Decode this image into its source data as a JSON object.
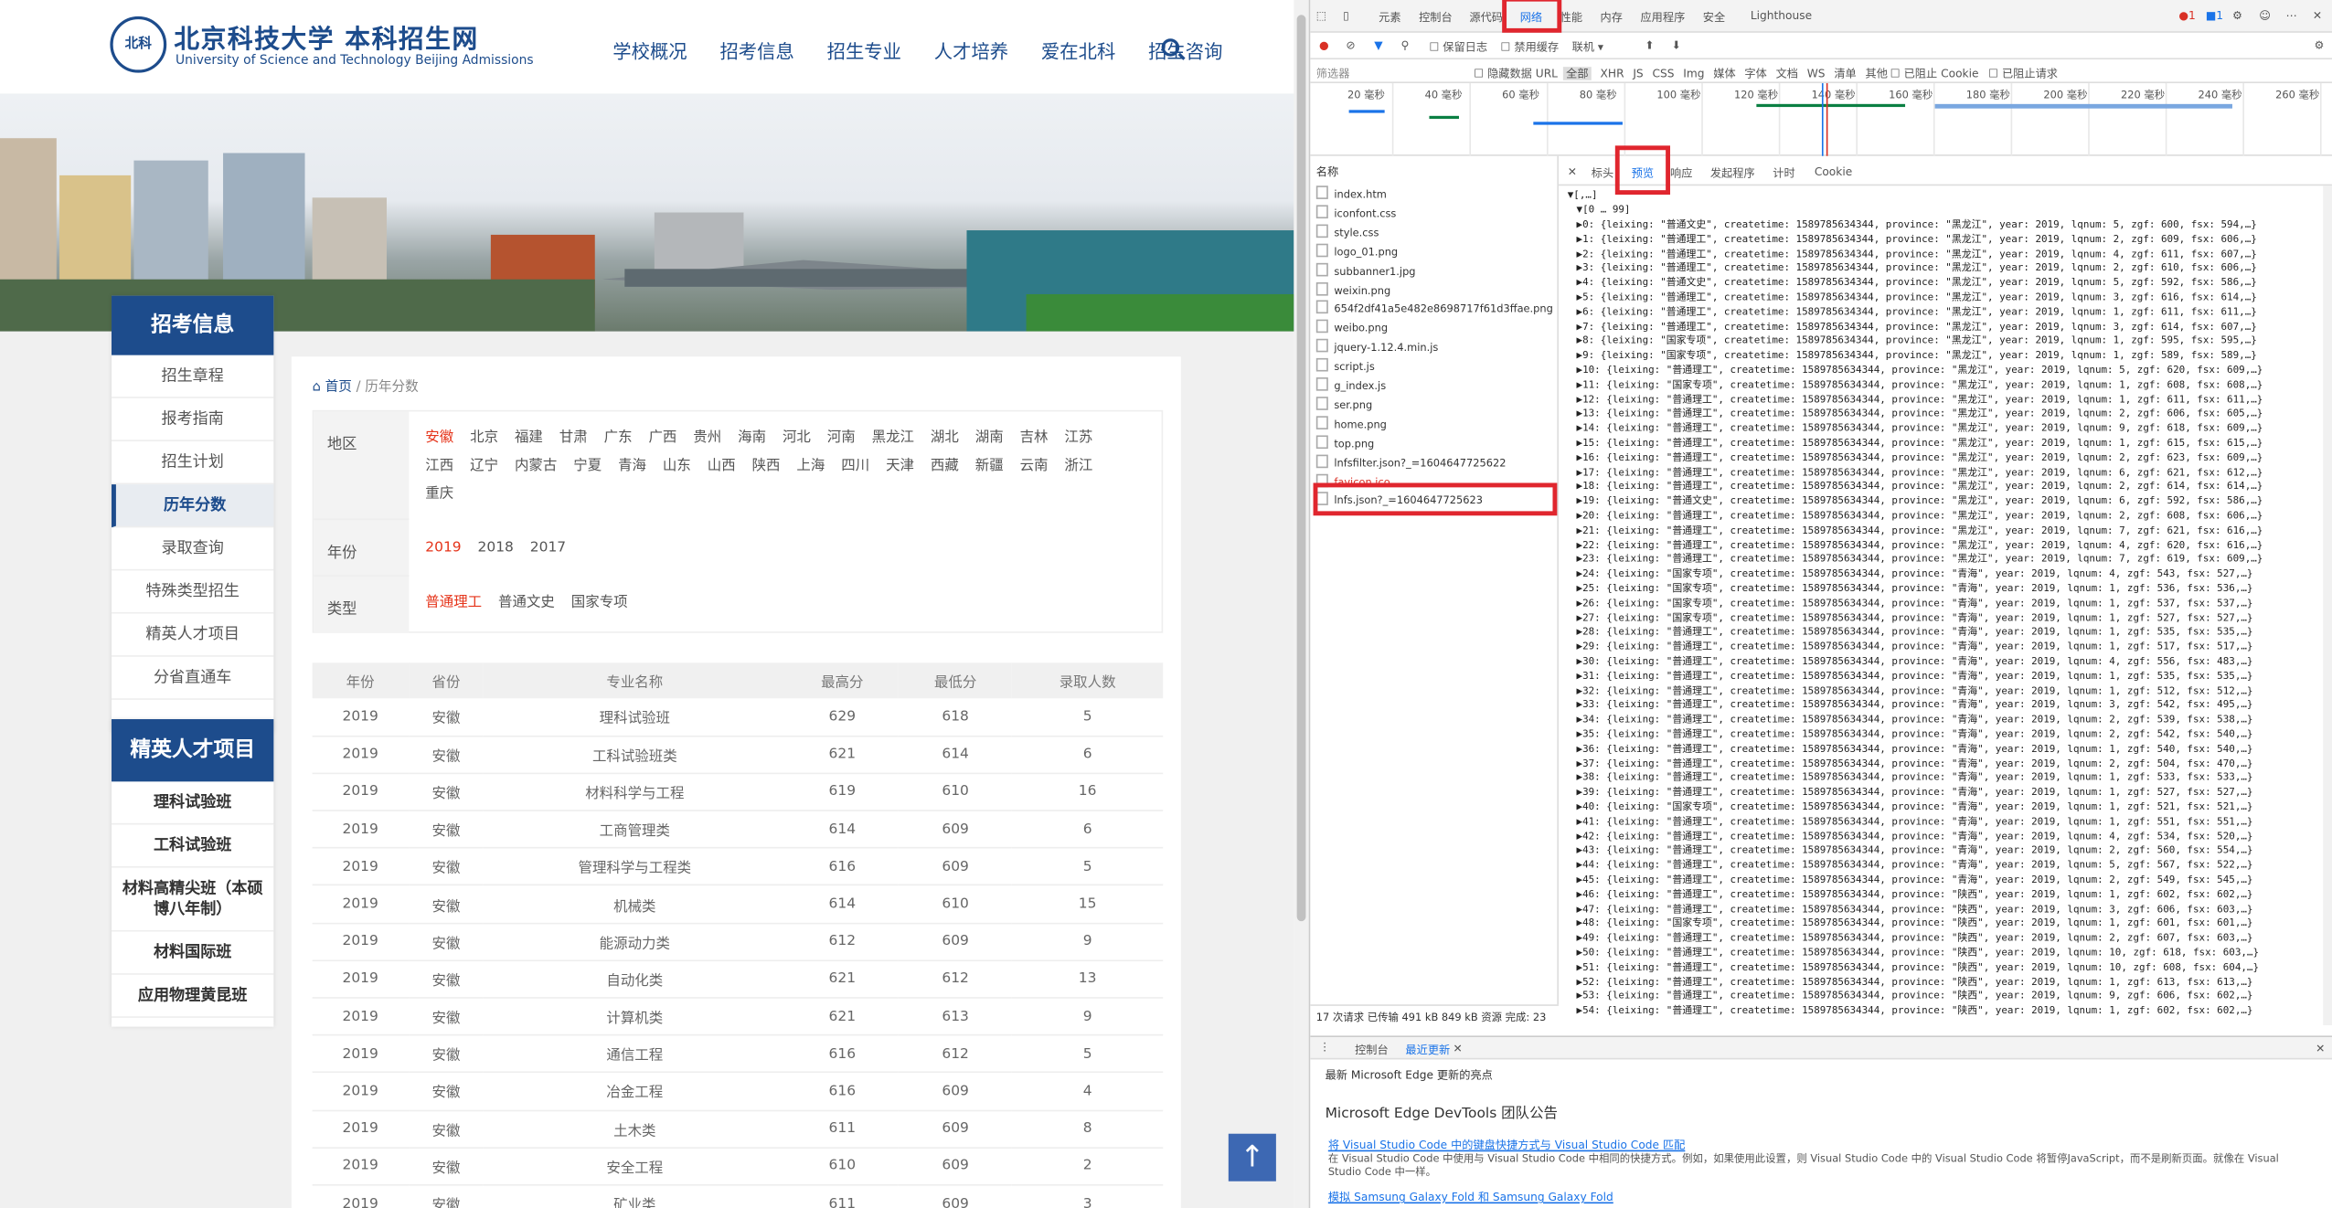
{
  "site": {
    "logo_seal": "北科",
    "logo_cn": "北京科技大学 本科招生网",
    "logo_en": "University of Science and Technology Beijing Admissions",
    "nav": [
      "学校概况",
      "招考信息",
      "招生专业",
      "人才培养",
      "爱在北科",
      "招生咨询"
    ],
    "sidebar1": {
      "title": "招考信息",
      "items": [
        "招生章程",
        "报考指南",
        "招生计划",
        "历年分数",
        "录取查询",
        "特殊类型招生",
        "精英人才项目",
        "分省直通车"
      ],
      "active": 3
    },
    "sidebar2": {
      "title": "精英人才项目",
      "items": [
        "理科试验班",
        "工科试验班",
        "材料高精尖班（本硕博八年制）",
        "材料国际班",
        "应用物理黄昆班"
      ]
    },
    "breadcrumb": {
      "home": "首页",
      "sep": "/",
      "current": "历年分数"
    },
    "filters": {
      "region_label": "地区",
      "regions_row1": [
        "安徽",
        "北京",
        "福建",
        "甘肃",
        "广东",
        "广西",
        "贵州",
        "海南",
        "河北",
        "河南",
        "黑龙江",
        "湖北",
        "湖南",
        "吉林",
        "江苏"
      ],
      "regions_row2": [
        "江西",
        "辽宁",
        "内蒙古",
        "宁夏",
        "青海",
        "山东",
        "山西",
        "陕西",
        "上海",
        "四川",
        "天津",
        "西藏",
        "新疆",
        "云南",
        "浙江"
      ],
      "regions_row3": [
        "重庆"
      ],
      "year_label": "年份",
      "years": [
        "2019",
        "2018",
        "2017"
      ],
      "type_label": "类型",
      "types": [
        "普通理工",
        "普通文史",
        "国家专项"
      ]
    },
    "table": {
      "headers": [
        "年份",
        "省份",
        "专业名称",
        "最高分",
        "最低分",
        "录取人数"
      ],
      "rows": [
        [
          "2019",
          "安徽",
          "理科试验班",
          "629",
          "618",
          "5"
        ],
        [
          "2019",
          "安徽",
          "工科试验班类",
          "621",
          "614",
          "6"
        ],
        [
          "2019",
          "安徽",
          "材料科学与工程",
          "619",
          "610",
          "16"
        ],
        [
          "2019",
          "安徽",
          "工商管理类",
          "614",
          "609",
          "6"
        ],
        [
          "2019",
          "安徽",
          "管理科学与工程类",
          "616",
          "609",
          "5"
        ],
        [
          "2019",
          "安徽",
          "机械类",
          "614",
          "610",
          "15"
        ],
        [
          "2019",
          "安徽",
          "能源动力类",
          "612",
          "609",
          "9"
        ],
        [
          "2019",
          "安徽",
          "自动化类",
          "621",
          "612",
          "13"
        ],
        [
          "2019",
          "安徽",
          "计算机类",
          "621",
          "613",
          "9"
        ],
        [
          "2019",
          "安徽",
          "通信工程",
          "616",
          "612",
          "5"
        ],
        [
          "2019",
          "安徽",
          "冶金工程",
          "616",
          "609",
          "4"
        ],
        [
          "2019",
          "安徽",
          "土木类",
          "611",
          "609",
          "8"
        ],
        [
          "2019",
          "安徽",
          "安全工程",
          "610",
          "609",
          "2"
        ],
        [
          "2019",
          "安徽",
          "矿业类",
          "611",
          "609",
          "3"
        ]
      ]
    },
    "backtop": "↑"
  },
  "devtools": {
    "tabs": [
      "元素",
      "控制台",
      "源代码",
      "网络",
      "性能",
      "内存",
      "应用程序",
      "安全",
      "Lighthouse"
    ],
    "badges": {
      "errors": "1",
      "warnings": "1"
    },
    "toolbar": {
      "preserve_log": "保留日志",
      "disable_cache": "禁用缓存",
      "throttle": "联机"
    },
    "filterbar": {
      "placeholder": "筛选器",
      "hide_data_url": "隐藏数据 URL",
      "types": [
        "全部",
        "XHR",
        "JS",
        "CSS",
        "Img",
        "媒体",
        "字体",
        "文档",
        "WS",
        "清单",
        "其他"
      ],
      "blocked_cookie": "已阻止 Cookie",
      "blocked_requests": "已阻止请求"
    },
    "timeline_ticks": [
      "20 毫秒",
      "40 毫秒",
      "60 毫秒",
      "80 毫秒",
      "100 毫秒",
      "120 毫秒",
      "140 毫秒",
      "160 毫秒",
      "180 毫秒",
      "200 毫秒",
      "220 毫秒",
      "240 毫秒",
      "260 毫秒"
    ],
    "name_header": "名称",
    "files": [
      "index.htm",
      "iconfont.css",
      "style.css",
      "logo_01.png",
      "subbanner1.jpg",
      "weixin.png",
      "654f2df41a5e482e8698717f61d3ffae.png",
      "weibo.png",
      "jquery-1.12.4.min.js",
      "script.js",
      "g_index.js",
      "ser.png",
      "home.png",
      "top.png",
      "lnfsfilter.json?_=1604647725622",
      "favicon.ico",
      "lnfs.json?_=1604647725623"
    ],
    "subtabs": [
      "标头",
      "预览",
      "响应",
      "发起程序",
      "计时",
      "Cookie"
    ],
    "preview": {
      "root": "▼[,…]",
      "group": "▼[0 … 99]",
      "rows": [
        "▶0: {leixing: \"普通文史\", createtime: 1589785634344, province: \"黑龙江\", year: 2019, lqnum: 5, zgf: 600, fsx: 594,…}",
        "▶1: {leixing: \"普通理工\", createtime: 1589785634344, province: \"黑龙江\", year: 2019, lqnum: 2, zgf: 609, fsx: 606,…}",
        "▶2: {leixing: \"普通理工\", createtime: 1589785634344, province: \"黑龙江\", year: 2019, lqnum: 4, zgf: 611, fsx: 607,…}",
        "▶3: {leixing: \"普通理工\", createtime: 1589785634344, province: \"黑龙江\", year: 2019, lqnum: 2, zgf: 610, fsx: 606,…}",
        "▶4: {leixing: \"普通文史\", createtime: 1589785634344, province: \"黑龙江\", year: 2019, lqnum: 5, zgf: 592, fsx: 586,…}",
        "▶5: {leixing: \"普通理工\", createtime: 1589785634344, province: \"黑龙江\", year: 2019, lqnum: 3, zgf: 616, fsx: 614,…}",
        "▶6: {leixing: \"普通理工\", createtime: 1589785634344, province: \"黑龙江\", year: 2019, lqnum: 1, zgf: 611, fsx: 611,…}",
        "▶7: {leixing: \"普通理工\", createtime: 1589785634344, province: \"黑龙江\", year: 2019, lqnum: 3, zgf: 614, fsx: 607,…}",
        "▶8: {leixing: \"国家专项\", createtime: 1589785634344, province: \"黑龙江\", year: 2019, lqnum: 1, zgf: 595, fsx: 595,…}",
        "▶9: {leixing: \"国家专项\", createtime: 1589785634344, province: \"黑龙江\", year: 2019, lqnum: 1, zgf: 589, fsx: 589,…}",
        "▶10: {leixing: \"普通理工\", createtime: 1589785634344, province: \"黑龙江\", year: 2019, lqnum: 5, zgf: 620, fsx: 609,…}",
        "▶11: {leixing: \"国家专项\", createtime: 1589785634344, province: \"黑龙江\", year: 2019, lqnum: 1, zgf: 608, fsx: 608,…}",
        "▶12: {leixing: \"普通理工\", createtime: 1589785634344, province: \"黑龙江\", year: 2019, lqnum: 1, zgf: 611, fsx: 611,…}",
        "▶13: {leixing: \"普通理工\", createtime: 1589785634344, province: \"黑龙江\", year: 2019, lqnum: 2, zgf: 606, fsx: 605,…}",
        "▶14: {leixing: \"普通理工\", createtime: 1589785634344, province: \"黑龙江\", year: 2019, lqnum: 9, zgf: 618, fsx: 609,…}",
        "▶15: {leixing: \"普通理工\", createtime: 1589785634344, province: \"黑龙江\", year: 2019, lqnum: 1, zgf: 615, fsx: 615,…}",
        "▶16: {leixing: \"普通理工\", createtime: 1589785634344, province: \"黑龙江\", year: 2019, lqnum: 2, zgf: 623, fsx: 609,…}",
        "▶17: {leixing: \"普通理工\", createtime: 1589785634344, province: \"黑龙江\", year: 2019, lqnum: 6, zgf: 621, fsx: 612,…}",
        "▶18: {leixing: \"普通理工\", createtime: 1589785634344, province: \"黑龙江\", year: 2019, lqnum: 2, zgf: 614, fsx: 614,…}",
        "▶19: {leixing: \"普通文史\", createtime: 1589785634344, province: \"黑龙江\", year: 2019, lqnum: 6, zgf: 592, fsx: 586,…}",
        "▶20: {leixing: \"普通理工\", createtime: 1589785634344, province: \"黑龙江\", year: 2019, lqnum: 2, zgf: 608, fsx: 606,…}",
        "▶21: {leixing: \"普通理工\", createtime: 1589785634344, province: \"黑龙江\", year: 2019, lqnum: 7, zgf: 621, fsx: 616,…}",
        "▶22: {leixing: \"普通理工\", createtime: 1589785634344, province: \"黑龙江\", year: 2019, lqnum: 4, zgf: 620, fsx: 616,…}",
        "▶23: {leixing: \"普通理工\", createtime: 1589785634344, province: \"黑龙江\", year: 2019, lqnum: 7, zgf: 619, fsx: 609,…}",
        "▶24: {leixing: \"国家专项\", createtime: 1589785634344, province: \"青海\", year: 2019, lqnum: 4, zgf: 543, fsx: 527,…}",
        "▶25: {leixing: \"国家专项\", createtime: 1589785634344, province: \"青海\", year: 2019, lqnum: 1, zgf: 536, fsx: 536,…}",
        "▶26: {leixing: \"国家专项\", createtime: 1589785634344, province: \"青海\", year: 2019, lqnum: 1, zgf: 537, fsx: 537,…}",
        "▶27: {leixing: \"国家专项\", createtime: 1589785634344, province: \"青海\", year: 2019, lqnum: 1, zgf: 527, fsx: 527,…}",
        "▶28: {leixing: \"普通理工\", createtime: 1589785634344, province: \"青海\", year: 2019, lqnum: 1, zgf: 535, fsx: 535,…}",
        "▶29: {leixing: \"普通理工\", createtime: 1589785634344, province: \"青海\", year: 2019, lqnum: 1, zgf: 517, fsx: 517,…}",
        "▶30: {leixing: \"普通理工\", createtime: 1589785634344, province: \"青海\", year: 2019, lqnum: 4, zgf: 556, fsx: 483,…}",
        "▶31: {leixing: \"普通理工\", createtime: 1589785634344, province: \"青海\", year: 2019, lqnum: 1, zgf: 535, fsx: 535,…}",
        "▶32: {leixing: \"普通理工\", createtime: 1589785634344, province: \"青海\", year: 2019, lqnum: 1, zgf: 512, fsx: 512,…}",
        "▶33: {leixing: \"普通理工\", createtime: 1589785634344, province: \"青海\", year: 2019, lqnum: 3, zgf: 542, fsx: 495,…}",
        "▶34: {leixing: \"普通理工\", createtime: 1589785634344, province: \"青海\", year: 2019, lqnum: 2, zgf: 539, fsx: 538,…}",
        "▶35: {leixing: \"普通理工\", createtime: 1589785634344, province: \"青海\", year: 2019, lqnum: 2, zgf: 542, fsx: 540,…}",
        "▶36: {leixing: \"普通理工\", createtime: 1589785634344, province: \"青海\", year: 2019, lqnum: 1, zgf: 540, fsx: 540,…}",
        "▶37: {leixing: \"普通理工\", createtime: 1589785634344, province: \"青海\", year: 2019, lqnum: 2, zgf: 504, fsx: 470,…}",
        "▶38: {leixing: \"普通理工\", createtime: 1589785634344, province: \"青海\", year: 2019, lqnum: 1, zgf: 533, fsx: 533,…}",
        "▶39: {leixing: \"普通理工\", createtime: 1589785634344, province: \"青海\", year: 2019, lqnum: 1, zgf: 527, fsx: 527,…}",
        "▶40: {leixing: \"国家专项\", createtime: 1589785634344, province: \"青海\", year: 2019, lqnum: 1, zgf: 521, fsx: 521,…}",
        "▶41: {leixing: \"普通理工\", createtime: 1589785634344, province: \"青海\", year: 2019, lqnum: 1, zgf: 551, fsx: 551,…}",
        "▶42: {leixing: \"普通理工\", createtime: 1589785634344, province: \"青海\", year: 2019, lqnum: 4, zgf: 534, fsx: 520,…}",
        "▶43: {leixing: \"普通理工\", createtime: 1589785634344, province: \"青海\", year: 2019, lqnum: 2, zgf: 560, fsx: 554,…}",
        "▶44: {leixing: \"普通理工\", createtime: 1589785634344, province: \"青海\", year: 2019, lqnum: 5, zgf: 567, fsx: 522,…}",
        "▶45: {leixing: \"普通理工\", createtime: 1589785634344, province: \"青海\", year: 2019, lqnum: 2, zgf: 549, fsx: 545,…}",
        "▶46: {leixing: \"普通理工\", createtime: 1589785634344, province: \"陕西\", year: 2019, lqnum: 1, zgf: 602, fsx: 602,…}",
        "▶47: {leixing: \"普通理工\", createtime: 1589785634344, province: \"陕西\", year: 2019, lqnum: 3, zgf: 606, fsx: 603,…}",
        "▶48: {leixing: \"国家专项\", createtime: 1589785634344, province: \"陕西\", year: 2019, lqnum: 1, zgf: 601, fsx: 601,…}",
        "▶49: {leixing: \"普通理工\", createtime: 1589785634344, province: \"陕西\", year: 2019, lqnum: 2, zgf: 607, fsx: 603,…}",
        "▶50: {leixing: \"普通理工\", createtime: 1589785634344, province: \"陕西\", year: 2019, lqnum: 10, zgf: 618, fsx: 603,…}",
        "▶51: {leixing: \"普通理工\", createtime: 1589785634344, province: \"陕西\", year: 2019, lqnum: 10, zgf: 608, fsx: 604,…}",
        "▶52: {leixing: \"普通理工\", createtime: 1589785634344, province: \"陕西\", year: 2019, lqnum: 1, zgf: 613, fsx: 613,…}",
        "▶53: {leixing: \"普通理工\", createtime: 1589785634344, province: \"陕西\", year: 2019, lqnum: 9, zgf: 606, fsx: 602,…}",
        "▶54: {leixing: \"普通理工\", createtime: 1589785634344, province: \"陕西\", year: 2019, lqnum: 1, zgf: 602, fsx: 602,…}"
      ]
    },
    "status": "17 次请求  已传输 491 kB  849 kB 资源  完成: 23",
    "drawer": {
      "tabs": [
        "控制台",
        "最近更新"
      ],
      "subtitle": "最新 Microsoft Edge 更新的亮点",
      "title": "Microsoft Edge DevTools 团队公告",
      "link1": "将 Visual Studio Code 中的键盘快捷方式与 Visual Studio Code 匹配",
      "desc1": "在 Visual Studio Code 中使用与 Visual Studio Code 中相同的快捷方式。例如，如果使用此设置，则 Visual Studio Code 中的 Visual Studio Code 将暂停JavaScript，而不是刷新页面。就像在 Visual Studio Code 中一样。",
      "link2": "模拟 Samsung Galaxy Fold 和 Samsung Galaxy Fold"
    }
  }
}
